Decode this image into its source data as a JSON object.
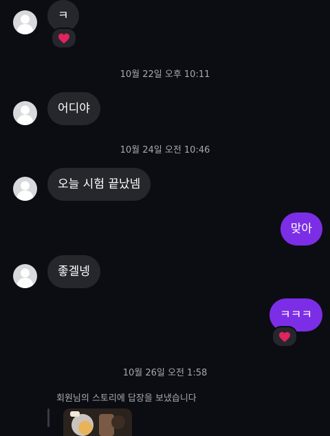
{
  "messages": {
    "m1": {
      "text": "ㅋ",
      "reaction": "heart-icon"
    },
    "m2": {
      "text": "어디야"
    },
    "m3": {
      "text": "오늘 시험 끝났넴"
    },
    "m4": {
      "text": "맞아"
    },
    "m5": {
      "text": "좋겔넹"
    },
    "m6": {
      "text": "ㅋㅋㅋ",
      "reaction": "heart-icon"
    }
  },
  "timestamps": {
    "t1": "10월 22일 오후 10:11",
    "t2": "10월 24일 오전 10:46",
    "t3": "10월 26일 오전 1:58"
  },
  "story_reply": {
    "text": "회원님의 스토리에 답장을 보냈습니다"
  },
  "colors": {
    "background": "#0c0d12",
    "incoming_bubble": "#26272c",
    "outgoing_bubble": "#7c2ee6",
    "timestamp_text": "#a8a9ae",
    "heart": "#e0245e"
  }
}
